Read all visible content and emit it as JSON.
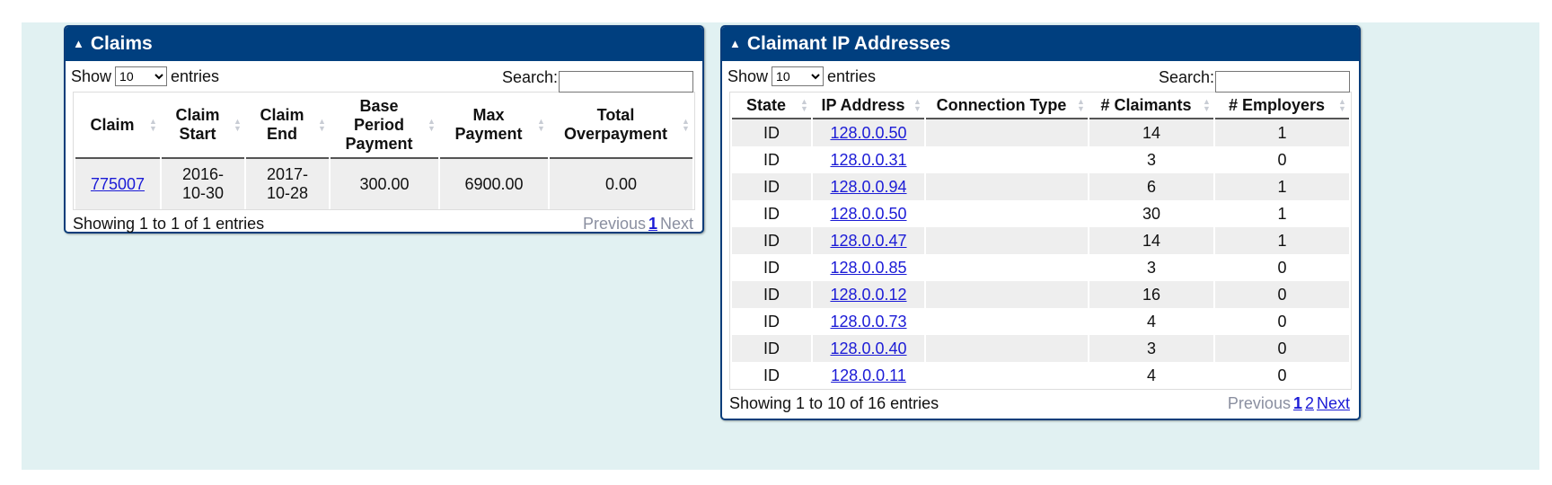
{
  "claims_panel": {
    "title": "Claims",
    "show_label": "Show",
    "page_size": "10",
    "entries_label": "entries",
    "search_label": "Search:",
    "search_value": "",
    "columns": [
      "Claim",
      "Claim Start",
      "Claim End",
      "Base Period Payment",
      "Max Payment",
      "Total Overpayment"
    ],
    "rows": [
      {
        "claim": "775007",
        "start": "2016-10-30",
        "end": "2017-10-28",
        "base": "300.00",
        "max": "6900.00",
        "overpayment": "0.00"
      }
    ],
    "info": "Showing 1 to 1 of 1 entries",
    "pager": {
      "previous": "Previous",
      "pages": [
        "1"
      ],
      "next": "Next",
      "current": "1"
    }
  },
  "ip_panel": {
    "title": "Claimant IP Addresses",
    "show_label": "Show",
    "page_size": "10",
    "entries_label": "entries",
    "search_label": "Search:",
    "search_value": "",
    "columns": [
      "State",
      "IP Address",
      "Connection Type",
      "# Claimants",
      "# Employers"
    ],
    "rows": [
      {
        "state": "ID",
        "ip": "128.0.0.50",
        "type": "",
        "claimants": "14",
        "employers": "1"
      },
      {
        "state": "ID",
        "ip": "128.0.0.31",
        "type": "",
        "claimants": "3",
        "employers": "0"
      },
      {
        "state": "ID",
        "ip": "128.0.0.94",
        "type": "",
        "claimants": "6",
        "employers": "1"
      },
      {
        "state": "ID",
        "ip": "128.0.0.50",
        "type": "",
        "claimants": "30",
        "employers": "1"
      },
      {
        "state": "ID",
        "ip": "128.0.0.47",
        "type": "",
        "claimants": "14",
        "employers": "1"
      },
      {
        "state": "ID",
        "ip": "128.0.0.85",
        "type": "",
        "claimants": "3",
        "employers": "0"
      },
      {
        "state": "ID",
        "ip": "128.0.0.12",
        "type": "",
        "claimants": "16",
        "employers": "0"
      },
      {
        "state": "ID",
        "ip": "128.0.0.73",
        "type": "",
        "claimants": "4",
        "employers": "0"
      },
      {
        "state": "ID",
        "ip": "128.0.0.40",
        "type": "",
        "claimants": "3",
        "employers": "0"
      },
      {
        "state": "ID",
        "ip": "128.0.0.11",
        "type": "",
        "claimants": "4",
        "employers": "0"
      }
    ],
    "info": "Showing 1 to 10 of 16 entries",
    "pager": {
      "previous": "Previous",
      "pages": [
        "1",
        "2"
      ],
      "next": "Next",
      "current": "1"
    }
  },
  "colors": {
    "header": "#003f7f",
    "background": "#e1f1f2",
    "link": "#1b1bd6",
    "row_stripe": "#eeeeee"
  }
}
